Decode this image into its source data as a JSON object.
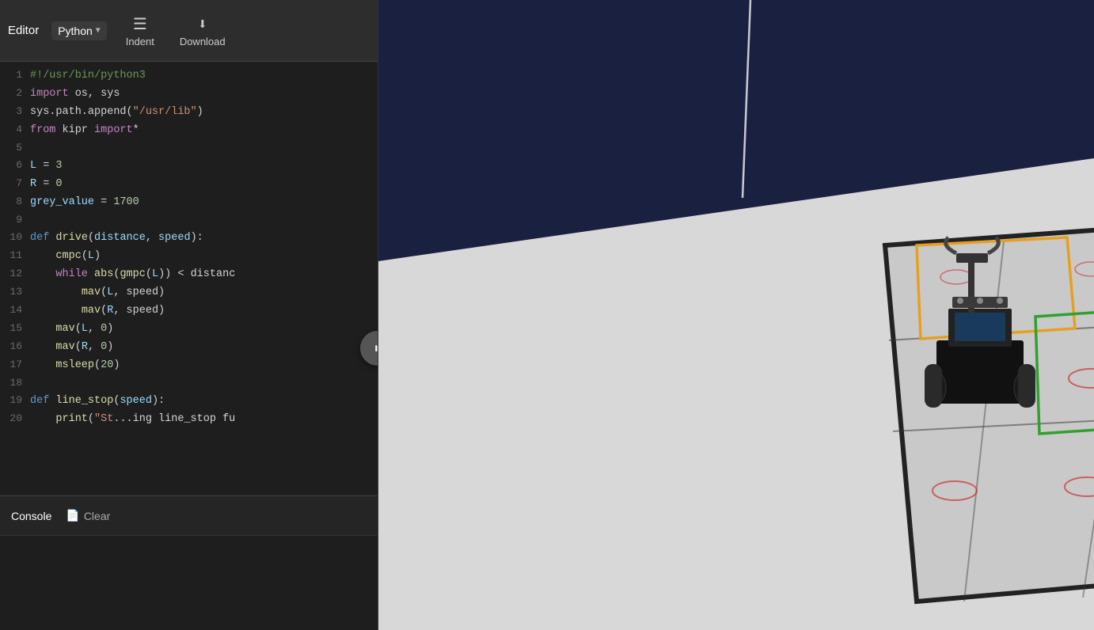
{
  "toolbar": {
    "editor_label": "Editor",
    "language": "Python",
    "indent_label": "Indent",
    "download_label": "Download"
  },
  "code": {
    "lines": [
      {
        "num": 1,
        "tokens": [
          {
            "type": "shebang",
            "text": "#!/usr/bin/python3"
          }
        ]
      },
      {
        "num": 2,
        "tokens": [
          {
            "type": "import",
            "text": "import"
          },
          {
            "type": "plain",
            "text": " os, sys"
          }
        ]
      },
      {
        "num": 3,
        "tokens": [
          {
            "type": "plain",
            "text": "sys.path.append("
          },
          {
            "type": "str",
            "text": "\"/usr/lib\""
          },
          {
            "type": "plain",
            "text": ")"
          }
        ]
      },
      {
        "num": 4,
        "tokens": [
          {
            "type": "from",
            "text": "from"
          },
          {
            "type": "plain",
            "text": " kipr "
          },
          {
            "type": "import",
            "text": "import"
          },
          {
            "type": "plain",
            "text": "*"
          }
        ]
      },
      {
        "num": 5,
        "tokens": [
          {
            "type": "plain",
            "text": ""
          }
        ]
      },
      {
        "num": 6,
        "tokens": [
          {
            "type": "var",
            "text": "L"
          },
          {
            "type": "plain",
            "text": " = "
          },
          {
            "type": "num",
            "text": "3"
          }
        ]
      },
      {
        "num": 7,
        "tokens": [
          {
            "type": "var",
            "text": "R"
          },
          {
            "type": "plain",
            "text": " = "
          },
          {
            "type": "num",
            "text": "0"
          }
        ]
      },
      {
        "num": 8,
        "tokens": [
          {
            "type": "var",
            "text": "grey_value"
          },
          {
            "type": "plain",
            "text": " = "
          },
          {
            "type": "num",
            "text": "1700"
          }
        ]
      },
      {
        "num": 9,
        "tokens": [
          {
            "type": "plain",
            "text": ""
          }
        ]
      },
      {
        "num": 10,
        "tokens": [
          {
            "type": "def",
            "text": "def"
          },
          {
            "type": "plain",
            "text": " "
          },
          {
            "type": "func",
            "text": "drive"
          },
          {
            "type": "plain",
            "text": "("
          },
          {
            "type": "param",
            "text": "distance, speed"
          },
          {
            "type": "plain",
            "text": "):"
          }
        ]
      },
      {
        "num": 11,
        "tokens": [
          {
            "type": "plain",
            "text": "    "
          },
          {
            "type": "func",
            "text": "cmpc"
          },
          {
            "type": "plain",
            "text": "("
          },
          {
            "type": "var",
            "text": "L"
          },
          {
            "type": "plain",
            "text": ")"
          }
        ]
      },
      {
        "num": 12,
        "tokens": [
          {
            "type": "plain",
            "text": "    "
          },
          {
            "type": "while",
            "text": "while"
          },
          {
            "type": "plain",
            "text": " "
          },
          {
            "type": "func",
            "text": "abs"
          },
          {
            "type": "plain",
            "text": "("
          },
          {
            "type": "func",
            "text": "gmpc"
          },
          {
            "type": "plain",
            "text": "("
          },
          {
            "type": "var",
            "text": "L"
          },
          {
            "type": "plain",
            "text": ")) < distanc"
          }
        ]
      },
      {
        "num": 13,
        "tokens": [
          {
            "type": "plain",
            "text": "        "
          },
          {
            "type": "func",
            "text": "mav"
          },
          {
            "type": "plain",
            "text": "("
          },
          {
            "type": "var",
            "text": "L"
          },
          {
            "type": "plain",
            "text": ", speed)"
          }
        ]
      },
      {
        "num": 14,
        "tokens": [
          {
            "type": "plain",
            "text": "        "
          },
          {
            "type": "func",
            "text": "mav"
          },
          {
            "type": "plain",
            "text": "("
          },
          {
            "type": "var",
            "text": "R"
          },
          {
            "type": "plain",
            "text": ", speed)"
          }
        ]
      },
      {
        "num": 15,
        "tokens": [
          {
            "type": "plain",
            "text": "    "
          },
          {
            "type": "func",
            "text": "mav"
          },
          {
            "type": "plain",
            "text": "("
          },
          {
            "type": "var",
            "text": "L"
          },
          {
            "type": "plain",
            "text": ", "
          },
          {
            "type": "num",
            "text": "0"
          },
          {
            "type": "plain",
            "text": ")"
          }
        ]
      },
      {
        "num": 16,
        "tokens": [
          {
            "type": "plain",
            "text": "    "
          },
          {
            "type": "func",
            "text": "mav"
          },
          {
            "type": "plain",
            "text": "("
          },
          {
            "type": "var",
            "text": "R"
          },
          {
            "type": "plain",
            "text": ", "
          },
          {
            "type": "num",
            "text": "0"
          },
          {
            "type": "plain",
            "text": ")"
          }
        ]
      },
      {
        "num": 17,
        "tokens": [
          {
            "type": "plain",
            "text": "    "
          },
          {
            "type": "func",
            "text": "msleep"
          },
          {
            "type": "plain",
            "text": "("
          },
          {
            "type": "num",
            "text": "20"
          },
          {
            "type": "plain",
            "text": ")"
          }
        ]
      },
      {
        "num": 18,
        "tokens": [
          {
            "type": "plain",
            "text": ""
          }
        ]
      },
      {
        "num": 19,
        "tokens": [
          {
            "type": "def",
            "text": "def"
          },
          {
            "type": "plain",
            "text": " "
          },
          {
            "type": "func",
            "text": "line_stop"
          },
          {
            "type": "plain",
            "text": "("
          },
          {
            "type": "param",
            "text": "speed"
          },
          {
            "type": "plain",
            "text": "):"
          }
        ]
      },
      {
        "num": 20,
        "tokens": [
          {
            "type": "plain",
            "text": "    "
          },
          {
            "type": "print",
            "text": "print"
          },
          {
            "type": "plain",
            "text": "("
          },
          {
            "type": "str",
            "text": "\"St"
          },
          {
            "type": "plain",
            "text": "...ing line_stop fu"
          }
        ]
      }
    ]
  },
  "console": {
    "label": "Console",
    "clear_label": "Clear"
  },
  "pause_btn": {
    "label": "⏸"
  }
}
